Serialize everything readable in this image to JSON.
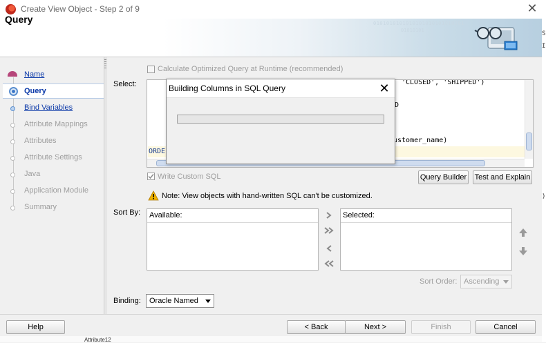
{
  "window": {
    "title": "Create View Object - Step 2 of 9",
    "close_glyph": "✕"
  },
  "banner": {
    "title": "Query",
    "binary_1": "0101010101010101010101010101",
    "binary_2": "01010101"
  },
  "nav": {
    "items": [
      {
        "label": "Name",
        "state": "link"
      },
      {
        "label": "Query",
        "state": "active"
      },
      {
        "label": "Bind Variables",
        "state": "link"
      },
      {
        "label": "Attribute Mappings",
        "state": "disabled"
      },
      {
        "label": "Attributes",
        "state": "disabled"
      },
      {
        "label": "Attribute Settings",
        "state": "disabled"
      },
      {
        "label": "Java",
        "state": "disabled"
      },
      {
        "label": "Application Module",
        "state": "disabled"
      },
      {
        "label": "Summary",
        "state": "disabled"
      }
    ]
  },
  "form": {
    "calc_optimized_label": "Calculate Optimized Query at Runtime (recommended)",
    "calc_optimized_checked": false,
    "select_label": "Select:",
    "sql_lines": [
      "'CLOSED', 'SHIPPED')",
      "D",
      "ustomer_name)",
      "ORDE"
    ],
    "write_custom_sql_label": "Write Custom SQL",
    "write_custom_sql_checked": true,
    "query_builder_label": "Query Builder",
    "test_explain_label": "Test and Explain",
    "note": "Note: View objects with hand-written SQL can't be customized.",
    "sort_by_label": "Sort By:",
    "available_header": "Available:",
    "selected_header": "Selected:",
    "sort_order_label": "Sort Order:",
    "sort_order_value": "Ascending",
    "binding_label": "Binding:",
    "binding_value": "Oracle Named"
  },
  "buttons": {
    "help": "Help",
    "back": "< Back",
    "next": "Next >",
    "finish": "Finish",
    "cancel": "Cancel"
  },
  "edge_chars": [
    "S",
    "I",
    "l",
    ")"
  ],
  "underlying_text": "Attribute12",
  "modal": {
    "title": "Building Columns in SQL Query",
    "close_glyph": "✕",
    "progress": 0.0
  },
  "colors": {
    "link": "#0a38a8",
    "disabled": "#9e9e9e",
    "progress_fill": "#06b025",
    "warning": "#f0b400"
  },
  "icons": [
    "app-icon",
    "close-icon",
    "banner-glasses-icon",
    "warning-icon",
    "move-right-icon",
    "move-all-right-icon",
    "move-left-icon",
    "move-all-left-icon",
    "move-up-icon",
    "move-down-icon",
    "caret-down-icon"
  ]
}
